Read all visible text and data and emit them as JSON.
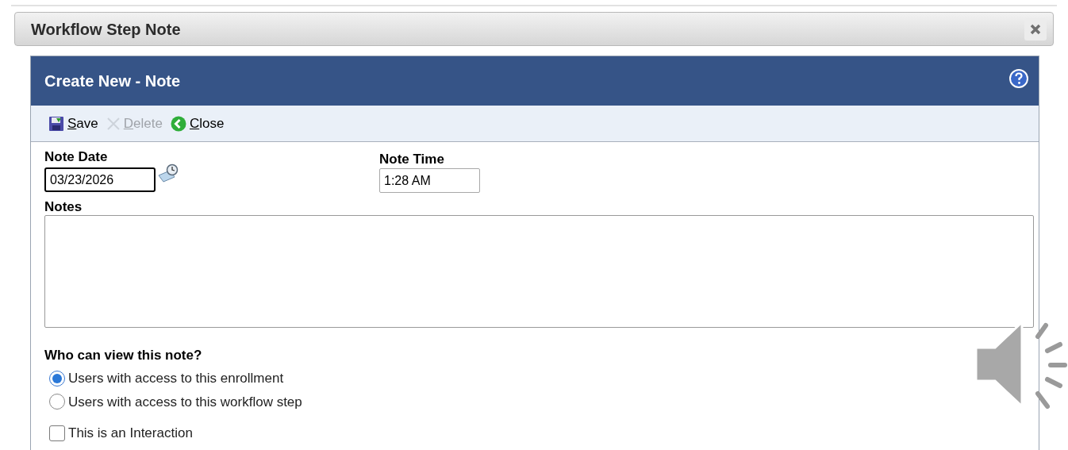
{
  "dialog": {
    "title": "Workflow Step Note"
  },
  "panel": {
    "title": "Create New - Note"
  },
  "toolbar": [
    {
      "kind": "save",
      "label": "Save",
      "disabled": false
    },
    {
      "kind": "delete",
      "label": "Delete",
      "disabled": true
    },
    {
      "kind": "close",
      "label": "Close",
      "disabled": false
    }
  ],
  "note_date": {
    "label": "Note Date",
    "value": "03/23/2026",
    "focused": true
  },
  "note_time": {
    "label": "Note Time",
    "value": "1:28 AM",
    "focused": false
  },
  "notes": {
    "label": "Notes"
  },
  "visibility": {
    "label": "Who can view this note?",
    "options": [
      {
        "label": "Users with access to this enrollment",
        "selected": true
      },
      {
        "label": "Users with access to this workflow step",
        "selected": false
      }
    ]
  },
  "interaction": {
    "label": "This is an Interaction",
    "checked": false
  }
}
